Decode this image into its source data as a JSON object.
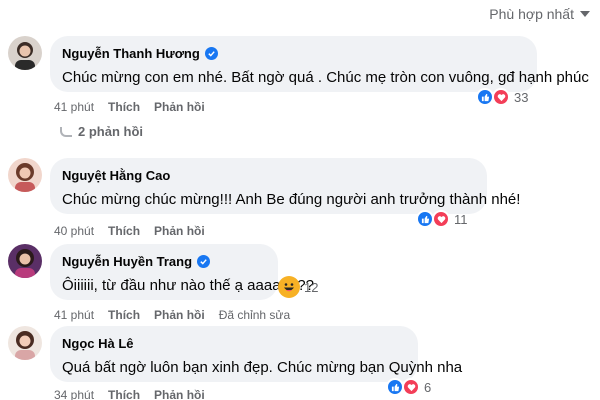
{
  "sort": {
    "label": "Phù hợp nhất"
  },
  "comments": [
    {
      "author": "Nguyễn Thanh Hương",
      "text": "Chúc mừng con em nhé. Bất ngờ quá . Chúc mẹ tròn con vuông, gđ hạnh phúc",
      "time": "41 phút",
      "like_label": "Thích",
      "reply_label": "Phản hồi",
      "reaction_count": "33"
    },
    {
      "author": "Nguyệt Hằng Cao",
      "text": "Chúc mừng chúc mừng!!! Anh Be đúng người anh trưởng thành nhé!",
      "time": "40 phút",
      "like_label": "Thích",
      "reply_label": "Phản hồi",
      "reaction_count": "11"
    },
    {
      "author": "Nguyễn Huyền Trang",
      "text": "Ôiiiiii, từ đầu như nào thế ạ aaaaa???",
      "time": "41 phút",
      "like_label": "Thích",
      "reply_label": "Phản hồi",
      "edited_label": "Đã chỉnh sửa",
      "reaction_count": "12"
    },
    {
      "author": "Ngọc Hà Lê",
      "text": "Quá bất ngờ luôn bạn xinh đẹp. Chúc mừng bạn Quỳnh nha",
      "time": "34 phút",
      "like_label": "Thích",
      "reply_label": "Phản hồi",
      "reaction_count": "6"
    }
  ],
  "replies_toggle": {
    "label": "2 phản hồi"
  },
  "colors": {
    "accent": "#1877f2",
    "bubble": "#f0f2f5",
    "muted": "#65676b",
    "heart": "#f33e58",
    "haha": "#f7b125"
  },
  "icons": {
    "verified": "verified-badge-icon",
    "like": "like-reaction-icon",
    "heart": "love-reaction-icon",
    "haha": "haha-reaction-icon",
    "sort": "chevron-down-icon"
  }
}
